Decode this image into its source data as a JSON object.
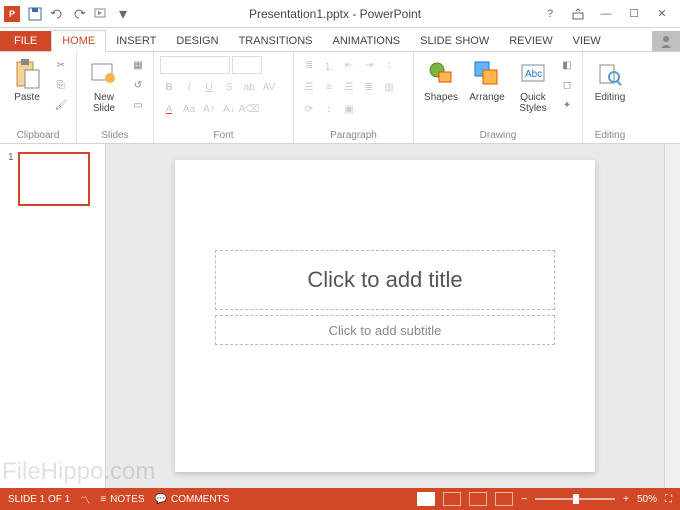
{
  "titlebar": {
    "title": "Presentation1.pptx - PowerPoint"
  },
  "tabs": {
    "file": "FILE",
    "items": [
      "HOME",
      "INSERT",
      "DESIGN",
      "TRANSITIONS",
      "ANIMATIONS",
      "SLIDE SHOW",
      "REVIEW",
      "VIEW"
    ],
    "active": "HOME"
  },
  "ribbon": {
    "clipboard": {
      "label": "Clipboard",
      "paste": "Paste"
    },
    "slides": {
      "label": "Slides",
      "new_slide": "New\nSlide"
    },
    "font": {
      "label": "Font"
    },
    "paragraph": {
      "label": "Paragraph"
    },
    "drawing": {
      "label": "Drawing",
      "shapes": "Shapes",
      "arrange": "Arrange",
      "quick_styles": "Quick\nStyles"
    },
    "editing": {
      "label": "Editing",
      "editing_btn": "Editing"
    }
  },
  "thumbs": {
    "num": "1"
  },
  "slide": {
    "title_placeholder": "Click to add title",
    "subtitle_placeholder": "Click to add subtitle"
  },
  "statusbar": {
    "slide_info": "SLIDE 1 OF 1",
    "lang": "",
    "notes": "NOTES",
    "comments": "COMMENTS",
    "zoom": "50%"
  },
  "watermark": "FileHippo.com"
}
